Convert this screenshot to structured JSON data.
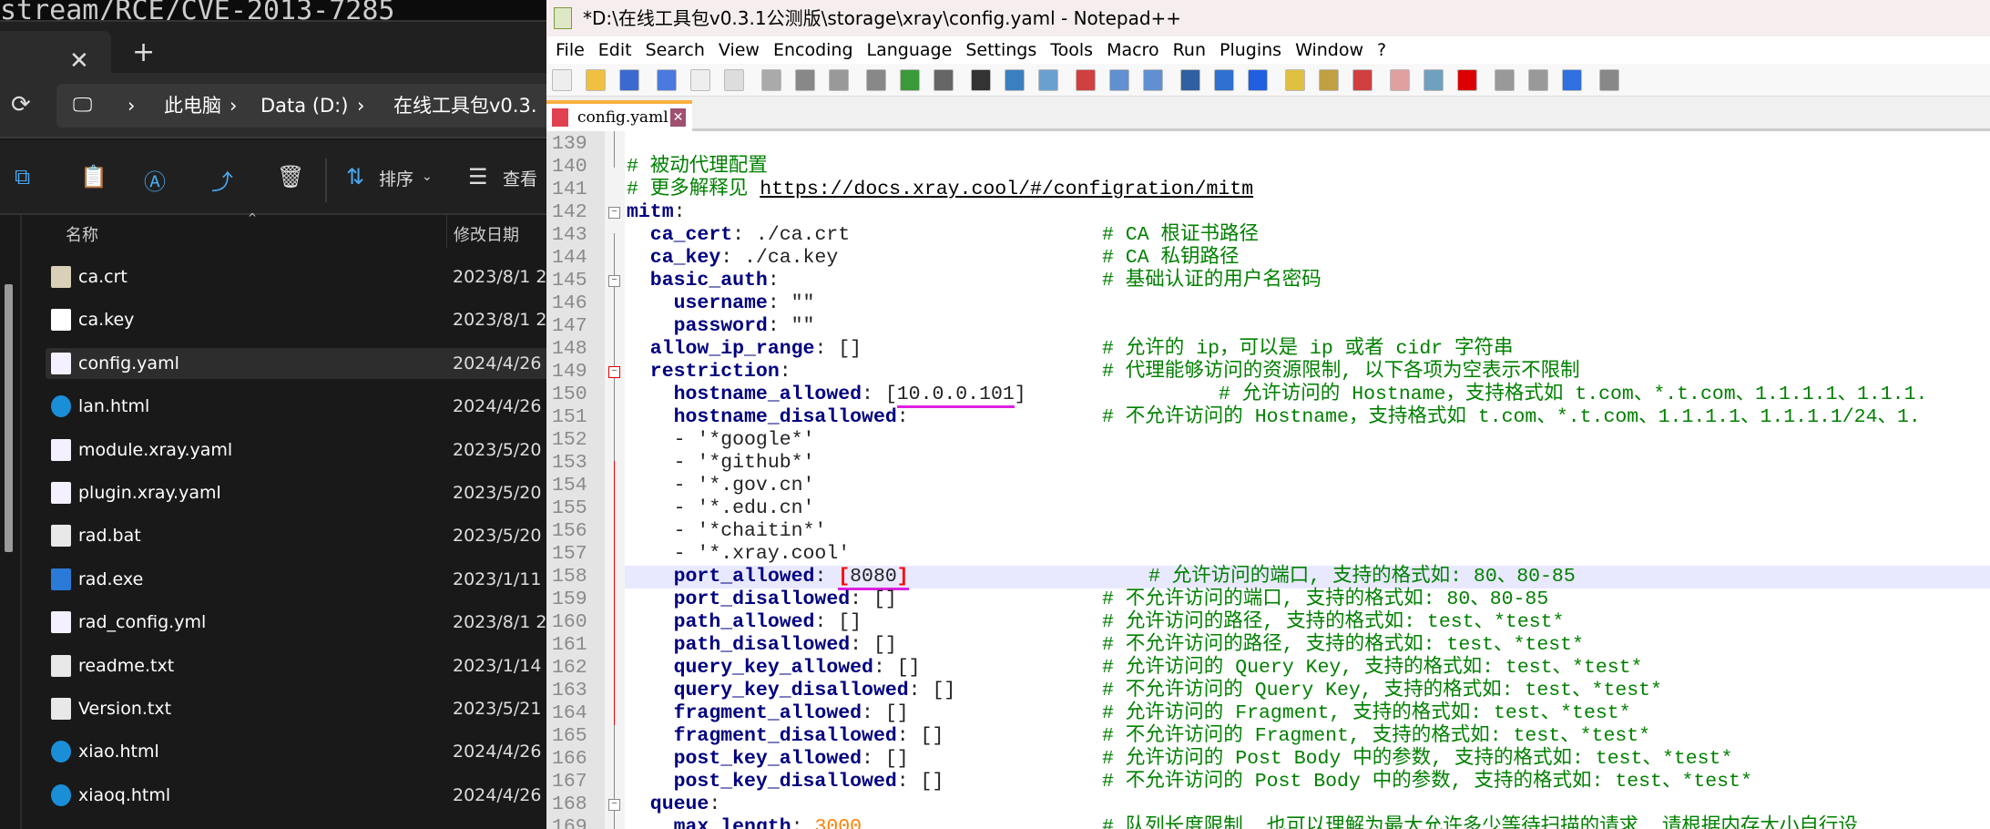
{
  "terminal": {
    "text": "stream/RCE/CVE-2013-7285"
  },
  "explorer": {
    "tab": {
      "close": "✕",
      "new": "+"
    },
    "breadcrumb": [
      "此电脑",
      "Data (D:)",
      "在线工具包v0.3."
    ],
    "toolbar": {
      "sort": "排序",
      "view": "查看"
    },
    "columns": {
      "name": "名称",
      "date": "修改日期"
    },
    "files": [
      {
        "name": "ca.crt",
        "date": "2023/8/1 2",
        "icon": "certificate",
        "color": "#d8d0b8"
      },
      {
        "name": "ca.key",
        "date": "2023/8/1 2",
        "icon": "file",
        "color": "#ffffff"
      },
      {
        "name": "config.yaml",
        "date": "2024/4/26",
        "icon": "yaml",
        "color": "#f4f0ff",
        "selected": true
      },
      {
        "name": "lan.html",
        "date": "2024/4/26",
        "icon": "edge",
        "color": "#1a8fd8"
      },
      {
        "name": "module.xray.yaml",
        "date": "2023/5/20",
        "icon": "yaml",
        "color": "#f4f0ff"
      },
      {
        "name": "plugin.xray.yaml",
        "date": "2023/5/20",
        "icon": "yaml",
        "color": "#f4f0ff"
      },
      {
        "name": "rad.bat",
        "date": "2023/5/20",
        "icon": "batch",
        "color": "#e8e8e8"
      },
      {
        "name": "rad.exe",
        "date": "2023/1/11",
        "icon": "exe",
        "color": "#2a7ad8"
      },
      {
        "name": "rad_config.yml",
        "date": "2023/8/1 2",
        "icon": "yaml",
        "color": "#f4f0ff"
      },
      {
        "name": "readme.txt",
        "date": "2023/1/14",
        "icon": "text",
        "color": "#e8e8e8"
      },
      {
        "name": "Version.txt",
        "date": "2023/5/21",
        "icon": "text",
        "color": "#e8e8e8"
      },
      {
        "name": "xiao.html",
        "date": "2024/4/26",
        "icon": "edge",
        "color": "#1a8fd8"
      },
      {
        "name": "xiaoq.html",
        "date": "2024/4/26",
        "icon": "edge",
        "color": "#1a8fd8"
      }
    ]
  },
  "notepad": {
    "title": "*D:\\在线工具包v0.3.1公测版\\storage\\xray\\config.yaml - Notepad++",
    "menu": [
      "File",
      "Edit",
      "Search",
      "View",
      "Encoding",
      "Language",
      "Settings",
      "Tools",
      "Macro",
      "Run",
      "Plugins",
      "Window",
      "?"
    ],
    "tab": "config.yaml",
    "lines": [
      {
        "n": "139",
        "k": "",
        "v": "",
        "c": ""
      },
      {
        "n": "140",
        "k": "",
        "v": "",
        "c": "# 被动代理配置",
        "cpos": "inline"
      },
      {
        "n": "141",
        "k": "",
        "v": "",
        "c": "# 更多解释见 ",
        "link": "https://docs.xray.cool/#/configration/mitm",
        "cpos": "inline"
      },
      {
        "n": "142",
        "k": "mitm",
        "v": ":",
        "c": "",
        "fold": "box"
      },
      {
        "n": "143",
        "k": "  ca_cert",
        "v": ": ./ca.crt",
        "c": "# CA 根证书路径"
      },
      {
        "n": "144",
        "k": "  ca_key",
        "v": ": ./ca.key",
        "c": "# CA 私钥路径"
      },
      {
        "n": "145",
        "k": "  basic_auth",
        "v": ":",
        "c": "# 基础认证的用户名密码",
        "fold": "box"
      },
      {
        "n": "146",
        "k": "    username",
        "v": ": \"\"",
        "c": ""
      },
      {
        "n": "147",
        "k": "    password",
        "v": ": \"\"",
        "c": ""
      },
      {
        "n": "148",
        "k": "  allow_ip_range",
        "v": ": []",
        "c": "# 允许的 ip，可以是 ip 或者 cidr 字符串"
      },
      {
        "n": "149",
        "k": "  restriction",
        "v": ":",
        "c": "# 代理能够访问的资源限制, 以下各项为空表示不限制",
        "fold": "red"
      },
      {
        "n": "150",
        "k": "    hostname_allowed",
        "v": ": [",
        "mark": "10.0.0.101",
        "v2": "]",
        "c": "# 允许访问的 Hostname，支持格式如 t.com、*.t.com、1.1.1.1、1.1.1.",
        "cpos": "far"
      },
      {
        "n": "151",
        "k": "    hostname_disallowed",
        "v": ":",
        "c": "# 不允许访问的 Hostname，支持格式如 t.com、*.t.com、1.1.1.1、1.1.1.1/24、1."
      },
      {
        "n": "152",
        "k": "",
        "v": "    - '*google*'",
        "c": ""
      },
      {
        "n": "153",
        "k": "",
        "v": "    - '*github*'",
        "c": ""
      },
      {
        "n": "154",
        "k": "",
        "v": "    - '*.gov.cn'",
        "c": ""
      },
      {
        "n": "155",
        "k": "",
        "v": "    - '*.edu.cn'",
        "c": ""
      },
      {
        "n": "156",
        "k": "",
        "v": "    - '*chaitin*'",
        "c": ""
      },
      {
        "n": "157",
        "k": "",
        "v": "    - '*.xray.cool'",
        "c": ""
      },
      {
        "n": "158",
        "k": "    port_allowed",
        "v": ": ",
        "mark": "8080",
        "brackets": true,
        "c": "# 允许访问的端口, 支持的格式如: 80、80-85",
        "cpos": "mid",
        "current": true
      },
      {
        "n": "159",
        "k": "    port_disallowed",
        "v": ": []",
        "c": "# 不允许访问的端口, 支持的格式如: 80、80-85"
      },
      {
        "n": "160",
        "k": "    path_allowed",
        "v": ": []",
        "c": "# 允许访问的路径, 支持的格式如: test、*test*"
      },
      {
        "n": "161",
        "k": "    path_disallowed",
        "v": ": []",
        "c": "# 不允许访问的路径, 支持的格式如: test、*test*"
      },
      {
        "n": "162",
        "k": "    query_key_allowed",
        "v": ": []",
        "c": "# 允许访问的 Query Key, 支持的格式如: test、*test*"
      },
      {
        "n": "163",
        "k": "    query_key_disallowed",
        "v": ": []",
        "c": "# 不允许访问的 Query Key, 支持的格式如: test、*test*"
      },
      {
        "n": "164",
        "k": "    fragment_allowed",
        "v": ": []",
        "c": "# 允许访问的 Fragment, 支持的格式如: test、*test*"
      },
      {
        "n": "165",
        "k": "    fragment_disallowed",
        "v": ": []",
        "c": "# 不允许访问的 Fragment, 支持的格式如: test、*test*"
      },
      {
        "n": "166",
        "k": "    post_key_allowed",
        "v": ": []",
        "c": "# 允许访问的 Post Body 中的参数, 支持的格式如: test、*test*"
      },
      {
        "n": "167",
        "k": "    post_key_disallowed",
        "v": ": []",
        "c": "# 不允许访问的 Post Body 中的参数, 支持的格式如: test、*test*"
      },
      {
        "n": "168",
        "k": "  queue",
        "v": ":",
        "c": "",
        "fold": "box"
      },
      {
        "n": "169",
        "k": "    max_length",
        "v": ": ",
        "num": "3000",
        "c": "# 队列长度限制, 也可以理解为最大允许多少等待扫描的请求, 请根据内存大小自行设"
      }
    ]
  },
  "colors": {
    "key": "#000080",
    "comment": "#008000",
    "number": "#ff8000",
    "current_line": "#e8e8ff",
    "match_underline": "#e020e0"
  }
}
